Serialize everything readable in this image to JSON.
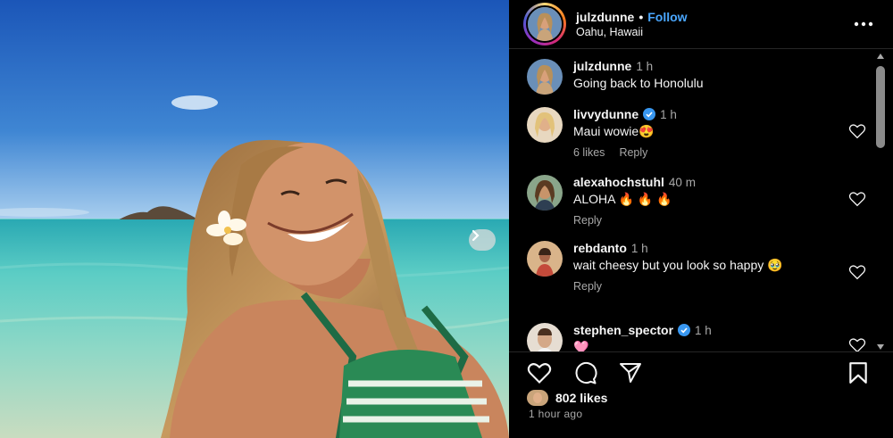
{
  "post": {
    "username": "julzdunne",
    "separator": "•",
    "follow_label": "Follow",
    "location": "Oahu, Hawaii"
  },
  "comments": [
    {
      "username": "julzdunne",
      "time": "1 h",
      "text": "Going back to Honolulu",
      "verified": false,
      "likes": "",
      "reply": ""
    },
    {
      "username": "livvydunne",
      "time": "1 h",
      "text": "Maui wowie😍",
      "verified": true,
      "likes": "6 likes",
      "reply": "Reply"
    },
    {
      "username": "alexahochstuhl",
      "time": "40 m",
      "text": "ALOHA 🔥 🔥 🔥",
      "verified": false,
      "likes": "",
      "reply": "Reply"
    },
    {
      "username": "rebdanto",
      "time": "1 h",
      "text": "wait cheesy but you look so happy 🥹",
      "verified": false,
      "likes": "",
      "reply": "Reply"
    },
    {
      "username": "stephen_spector",
      "time": "1 h",
      "text": "🩷",
      "verified": true,
      "likes": "",
      "reply": ""
    }
  ],
  "footer": {
    "likes": "802 likes",
    "time_ago": "1 hour ago"
  },
  "icons": {
    "more": "more-horizontal-icon",
    "like": "heart-icon",
    "comment": "comment-icon",
    "share": "send-icon",
    "save": "bookmark-icon",
    "next": "chevron-right-icon",
    "verified": "verified-badge-icon"
  },
  "colors": {
    "follow": "#4aa7ff",
    "verified": "#3897f0",
    "background": "#000000"
  }
}
